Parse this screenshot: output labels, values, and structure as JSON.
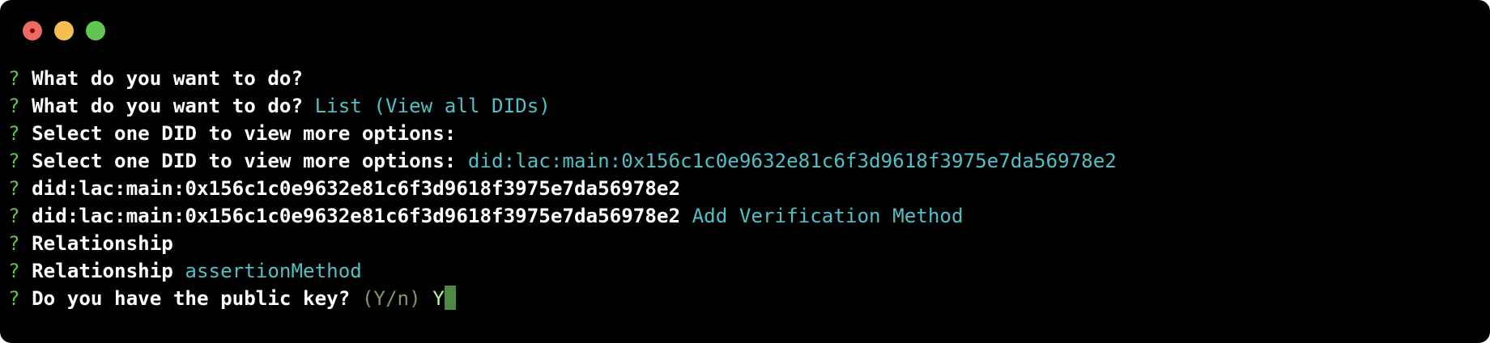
{
  "window": {
    "background": "#000000",
    "traffic_lights": [
      {
        "name": "close-button",
        "color": "#ed6a5e"
      },
      {
        "name": "minimize-button",
        "color": "#f5bf4f"
      },
      {
        "name": "zoom-button",
        "color": "#61c554"
      }
    ]
  },
  "colors": {
    "prompt": "#5fc24b",
    "question": "#ffffff",
    "answer": "#4fc1c6",
    "hint": "#7f9a68",
    "input": "#b9f0a8",
    "cursor": "#4f8a45"
  },
  "lines": [
    {
      "prompt": "?",
      "question": " What do you want to do?",
      "answer": ""
    },
    {
      "prompt": "?",
      "question": " What do you want to do?",
      "answer": " List (View all DIDs)"
    },
    {
      "prompt": "?",
      "question": " Select one DID to view more options:",
      "answer": ""
    },
    {
      "prompt": "?",
      "question": " Select one DID to view more options:",
      "answer": " did:lac:main:0x156c1c0e9632e81c6f3d9618f3975e7da56978e2"
    },
    {
      "prompt": "?",
      "question": " did:lac:main:0x156c1c0e9632e81c6f3d9618f3975e7da56978e2",
      "answer": ""
    },
    {
      "prompt": "?",
      "question": " did:lac:main:0x156c1c0e9632e81c6f3d9618f3975e7da56978e2",
      "answer": " Add Verification Method"
    },
    {
      "prompt": "?",
      "question": " Relationship",
      "answer": ""
    },
    {
      "prompt": "?",
      "question": " Relationship",
      "answer": " assertionMethod"
    }
  ],
  "active_line": {
    "prompt": "?",
    "question": " Do you have the public key?",
    "hint": " (Y/n)",
    "input": " Y"
  }
}
